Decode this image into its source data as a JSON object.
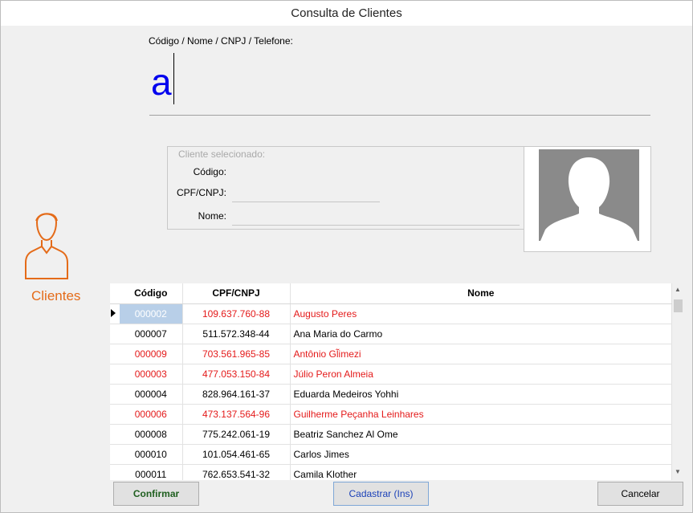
{
  "window": {
    "title": "Consulta de Clientes"
  },
  "search": {
    "label": "Código / Nome / CNPJ / Telefone:",
    "value": "a"
  },
  "selected": {
    "title": "Cliente selecionado:",
    "codigo_label": "Código:",
    "cpf_label": "CPF/CNPJ:",
    "nome_label": "Nome:"
  },
  "sidebar": {
    "label": "Clientes"
  },
  "grid": {
    "columns": [
      "Código",
      "CPF/CNPJ",
      "Nome"
    ],
    "rows": [
      {
        "codigo": "000002",
        "cpf": "109.637.760-88",
        "nome": "Augusto Peres",
        "color": "red"
      },
      {
        "codigo": "000007",
        "cpf": "511.572.348-44",
        "nome": "Ana Maria do Carmo",
        "color": "black"
      },
      {
        "codigo": "000009",
        "cpf": "703.561.965-85",
        "nome": "Antônio Gl̃imezi",
        "color": "red"
      },
      {
        "codigo": "000003",
        "cpf": "477.053.150-84",
        "nome": "Júlio Peron Almeia",
        "color": "red"
      },
      {
        "codigo": "000004",
        "cpf": "828.964.161-37",
        "nome": "Eduarda Medeiros Yohhi",
        "color": "black"
      },
      {
        "codigo": "000006",
        "cpf": "473.137.564-96",
        "nome": "Guilherme Peçanha Leinhares",
        "color": "red"
      },
      {
        "codigo": "000008",
        "cpf": "775.242.061-19",
        "nome": "Beatriz Sanchez Al Ome",
        "color": "black"
      },
      {
        "codigo": "000010",
        "cpf": "101.054.461-65",
        "nome": "Carlos Jimes",
        "color": "black"
      },
      {
        "codigo": "000011",
        "cpf": "762.653.541-32",
        "nome": "Camila Klother",
        "color": "black"
      }
    ]
  },
  "buttons": {
    "confirmar": "Confirmar",
    "cadastrar": "Cadastrar (Ins)",
    "cancelar": "Cancelar"
  },
  "colors": {
    "accent": "#e46b19",
    "red_row": "#e41a1a",
    "search_text": "#0000ee"
  }
}
